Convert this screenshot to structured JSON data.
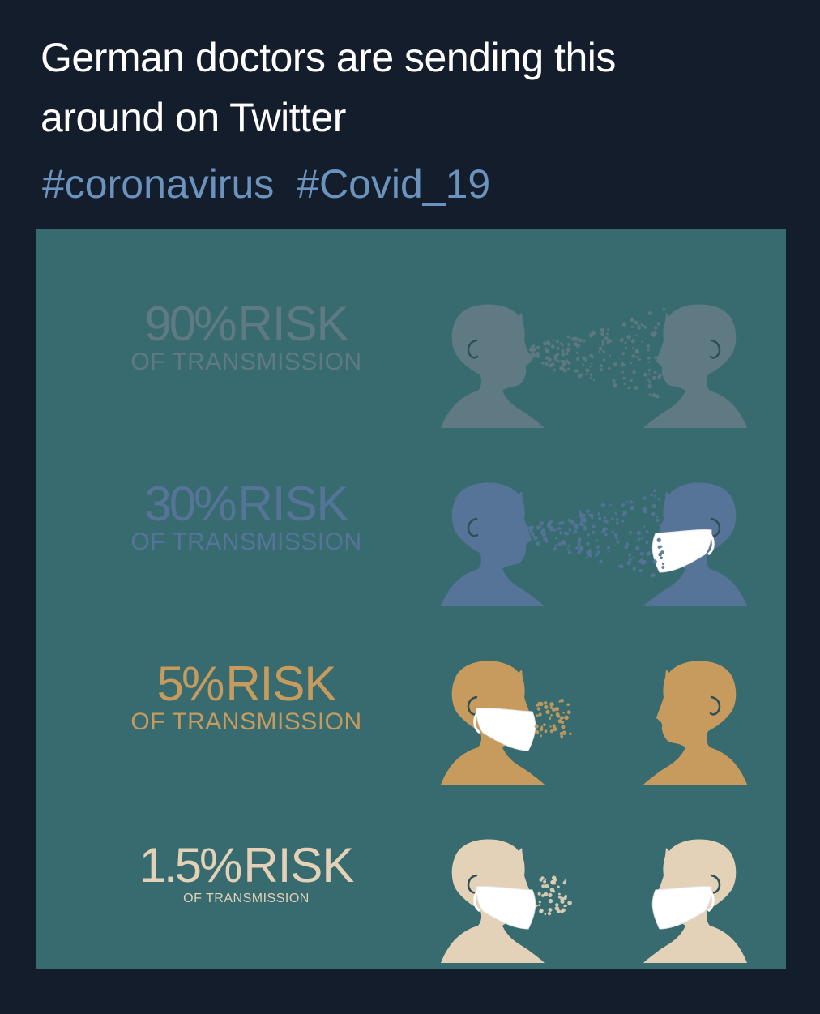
{
  "tweet": {
    "text_lines": [
      "German doctors are sending this",
      "around on Twitter"
    ],
    "hashtags": [
      "#coronavirus",
      "#Covid_19"
    ]
  },
  "infographic": {
    "background_color": "#386b6f",
    "rows": [
      {
        "percent": "90%",
        "risk_word": "RISK",
        "subtitle": "OF TRANSMISSION",
        "color": "#5f7a82",
        "left_mask": false,
        "right_mask": false,
        "droplets": "long"
      },
      {
        "percent": "30%",
        "risk_word": "RISK",
        "subtitle": "OF TRANSMISSION",
        "color": "#557498",
        "left_mask": false,
        "right_mask": true,
        "droplets": "long"
      },
      {
        "percent": "5%",
        "risk_word": "RISK",
        "subtitle": "OF TRANSMISSION",
        "color": "#c79b5e",
        "left_mask": true,
        "right_mask": false,
        "droplets": "short"
      },
      {
        "percent": "1.5%",
        "risk_word": "RISK",
        "subtitle": "OF TRANSMISSION",
        "color": "#e3d1b8",
        "left_mask": true,
        "right_mask": true,
        "droplets": "short"
      }
    ]
  }
}
